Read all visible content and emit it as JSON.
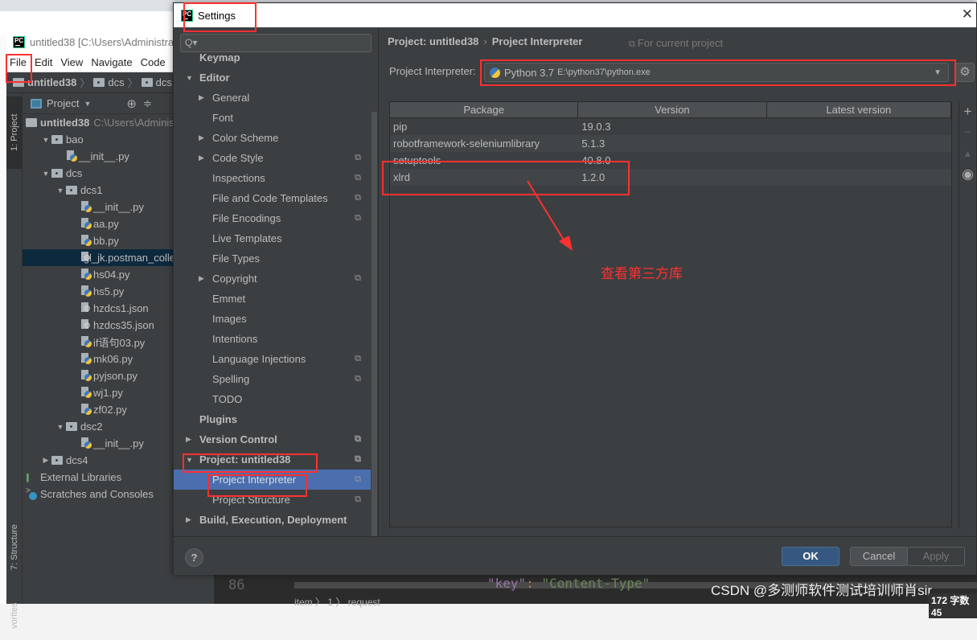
{
  "browser": {},
  "ide": {
    "title": "untitled38 [C:\\Users\\Administra",
    "menu": [
      "File",
      "Edit",
      "View",
      "Navigate",
      "Code"
    ],
    "breadcrumb": [
      "untitled38",
      "dcs",
      "dcs1"
    ],
    "tool_tabs": {
      "project": "1: Project",
      "structure": "7: Structure",
      "favorites": "vorites"
    },
    "project_panel": {
      "label": "Project",
      "tree": [
        {
          "label": "untitled38",
          "extra": "C:\\Users\\Adminis",
          "type": "root",
          "depth": 0
        },
        {
          "label": "bao",
          "type": "folder",
          "depth": 1,
          "expanded": true
        },
        {
          "label": "__init__.py",
          "type": "py",
          "depth": 2
        },
        {
          "label": "dcs",
          "type": "folder",
          "depth": 1,
          "expanded": true
        },
        {
          "label": "dcs1",
          "type": "folder",
          "depth": 2,
          "expanded": true
        },
        {
          "label": "__init__.py",
          "type": "py",
          "depth": 3
        },
        {
          "label": "aa.py",
          "type": "py",
          "depth": 3
        },
        {
          "label": "bb.py",
          "type": "py",
          "depth": 3
        },
        {
          "label": "gl_jk.postman_colle",
          "type": "json",
          "depth": 3,
          "selected": true
        },
        {
          "label": "hs04.py",
          "type": "py",
          "depth": 3
        },
        {
          "label": "hs5.py",
          "type": "py",
          "depth": 3
        },
        {
          "label": "hzdcs1.json",
          "type": "json",
          "depth": 3
        },
        {
          "label": "hzdcs35.json",
          "type": "json",
          "depth": 3
        },
        {
          "label": "if语句03.py",
          "type": "py",
          "depth": 3
        },
        {
          "label": "mk06.py",
          "type": "py",
          "depth": 3
        },
        {
          "label": "pyjson.py",
          "type": "py",
          "depth": 3
        },
        {
          "label": "wj1.py",
          "type": "py",
          "depth": 3
        },
        {
          "label": "zf02.py",
          "type": "py",
          "depth": 3
        },
        {
          "label": "dsc2",
          "type": "folder",
          "depth": 2,
          "expanded": true
        },
        {
          "label": "__init__.py",
          "type": "py",
          "depth": 3
        },
        {
          "label": "dcs4",
          "type": "folder",
          "depth": 1,
          "expanded": false
        },
        {
          "label": "External Libraries",
          "type": "lib",
          "depth": 0
        },
        {
          "label": "Scratches and Consoles",
          "type": "scratch",
          "depth": 0
        }
      ]
    },
    "editor": {
      "line_number": "86",
      "code_key": "\"key\"",
      "code_colon": ": ",
      "code_value": "\"Content-Type\"",
      "crumbs": "item  〉 1  〉 request"
    }
  },
  "settings": {
    "title": "Settings",
    "search_placeholder": "Q▾",
    "tree": [
      {
        "label": "Keymap",
        "bold": true,
        "level": 0
      },
      {
        "label": "Editor",
        "bold": true,
        "level": 0,
        "arrow": "down"
      },
      {
        "label": "General",
        "level": 1,
        "arrow": "right"
      },
      {
        "label": "Font",
        "level": 1
      },
      {
        "label": "Color Scheme",
        "level": 1,
        "arrow": "right"
      },
      {
        "label": "Code Style",
        "level": 1,
        "arrow": "right",
        "project": true
      },
      {
        "label": "Inspections",
        "level": 1,
        "project": true
      },
      {
        "label": "File and Code Templates",
        "level": 1,
        "project": true
      },
      {
        "label": "File Encodings",
        "level": 1,
        "project": true
      },
      {
        "label": "Live Templates",
        "level": 1
      },
      {
        "label": "File Types",
        "level": 1
      },
      {
        "label": "Copyright",
        "level": 1,
        "arrow": "right",
        "project": true
      },
      {
        "label": "Emmet",
        "level": 1
      },
      {
        "label": "Images",
        "level": 1
      },
      {
        "label": "Intentions",
        "level": 1
      },
      {
        "label": "Language Injections",
        "level": 1,
        "project": true
      },
      {
        "label": "Spelling",
        "level": 1,
        "project": true
      },
      {
        "label": "TODO",
        "level": 1
      },
      {
        "label": "Plugins",
        "bold": true,
        "level": 0
      },
      {
        "label": "Version Control",
        "bold": true,
        "level": 0,
        "arrow": "right",
        "project": true
      },
      {
        "label": "Project: untitled38",
        "bold": true,
        "level": 0,
        "arrow": "down",
        "project": true
      },
      {
        "label": "Project Interpreter",
        "level": 1,
        "project": true,
        "selected": true
      },
      {
        "label": "Project Structure",
        "level": 1,
        "project": true
      },
      {
        "label": "Build, Execution, Deployment",
        "bold": true,
        "level": 0,
        "arrow": "right"
      }
    ],
    "breadcrumb": {
      "parent": "Project: untitled38",
      "sep": "›",
      "current": "Project Interpreter"
    },
    "for_current_project": "For current project",
    "interpreter_label": "Project Interpreter:",
    "interpreter_name": "Python 3.7",
    "interpreter_path": "E:\\python37\\python.exe",
    "table": {
      "headers": [
        "Package",
        "Version",
        "Latest version"
      ],
      "rows": [
        [
          "pip",
          "19.0.3",
          ""
        ],
        [
          "robotframework-seleniumlibrary",
          "5.1.3",
          ""
        ],
        [
          "setuptools",
          "40.8.0",
          ""
        ],
        [
          "xlrd",
          "1.2.0",
          ""
        ]
      ]
    },
    "buttons": {
      "ok": "OK",
      "cancel": "Cancel",
      "apply": "Apply",
      "help": "?"
    }
  },
  "annotation": {
    "text": "查看第三方库",
    "color": "#ff3030"
  },
  "watermark": "CSDN @多测师软件测试培训师肖sir",
  "status_word_count": "172 字数  45",
  "colors": {
    "dialog_bg": "#3c3f41",
    "selection": "#4b6eaf",
    "ok_button": "#365880",
    "annotation_red": "#ff3030"
  }
}
